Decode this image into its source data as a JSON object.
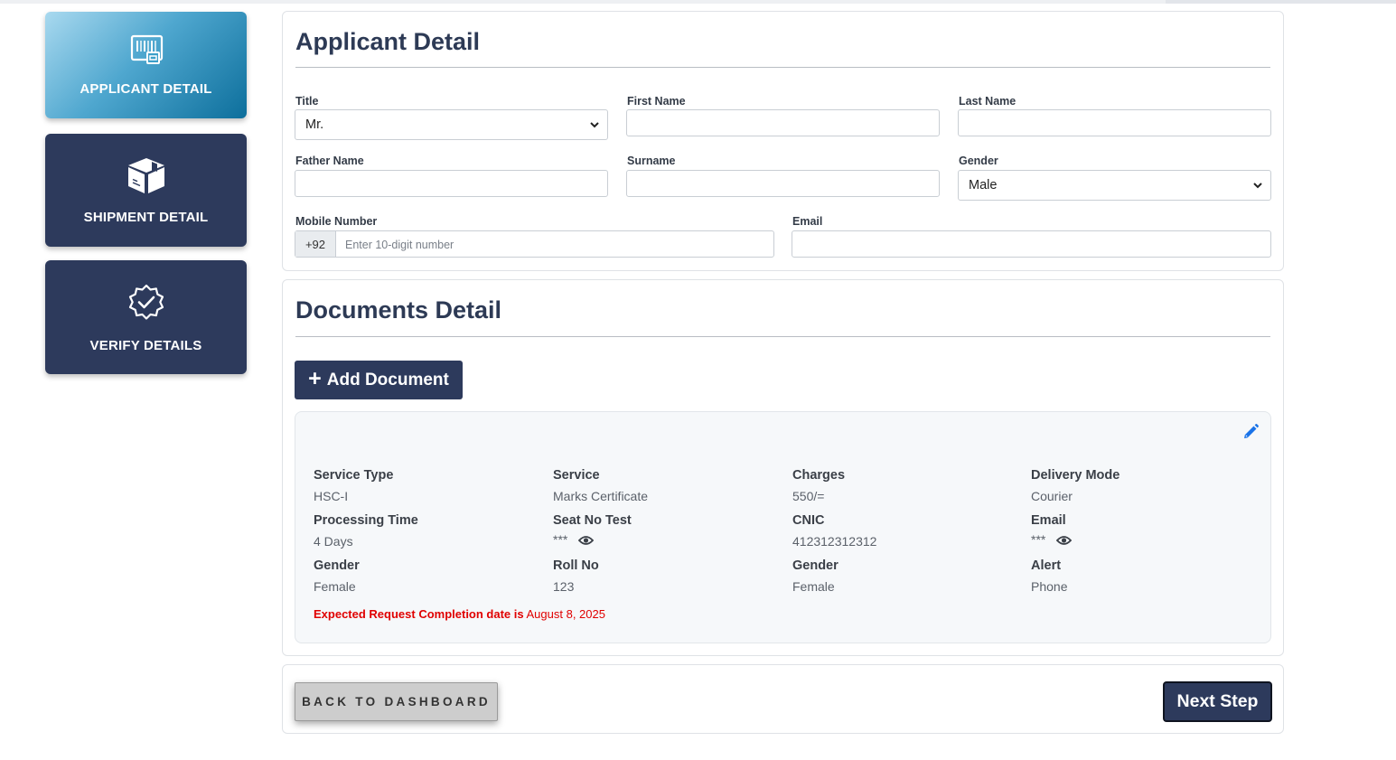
{
  "steps": [
    {
      "label": "APPLICANT DETAIL",
      "icon": "barcode-document-icon",
      "active": true
    },
    {
      "label": "SHIPMENT DETAIL",
      "icon": "package-box-icon",
      "active": false
    },
    {
      "label": "VERIFY DETAILS",
      "icon": "badge-check-icon",
      "active": false
    }
  ],
  "applicant": {
    "heading": "Applicant Detail",
    "title_label": "Title",
    "title_value": "Mr.",
    "first_name_label": "First Name",
    "first_name_value": "",
    "last_name_label": "Last Name",
    "last_name_value": "",
    "father_name_label": "Father Name",
    "father_name_value": "",
    "surname_label": "Surname",
    "surname_value": "",
    "gender_label": "Gender",
    "gender_value": "Male",
    "mobile_label": "Mobile Number",
    "mobile_prefix": "+92",
    "mobile_placeholder": "Enter 10-digit number",
    "email_label": "Email",
    "email_value": ""
  },
  "documents": {
    "heading": "Documents Detail",
    "add_button": "Add Document",
    "card": {
      "fields": [
        {
          "key": "Service Type",
          "value": "HSC-I"
        },
        {
          "key": "Service",
          "value": "Marks Certificate"
        },
        {
          "key": "Charges",
          "value": "550/="
        },
        {
          "key": "Delivery Mode",
          "value": "Courier"
        },
        {
          "key": "Processing Time",
          "value": "4 Days"
        },
        {
          "key": "Seat No Test",
          "value": "***",
          "masked": true
        },
        {
          "key": "CNIC",
          "value": "412312312312"
        },
        {
          "key": "Email",
          "value": "***",
          "masked": true
        },
        {
          "key": "Gender",
          "value": "Female"
        },
        {
          "key": "Roll No",
          "value": "123"
        },
        {
          "key": "Gender",
          "value": "Female"
        },
        {
          "key": "Alert",
          "value": "Phone"
        }
      ],
      "expected_label": "Expected Request Completion date is",
      "expected_date": "August 8, 2025"
    }
  },
  "footer": {
    "back_label": "BACK TO DASHBOARD",
    "next_label": "Next Step"
  },
  "colors": {
    "navy": "#2d3a5c",
    "accent_blue": "#1a73e8",
    "alert_red": "#e00000"
  }
}
